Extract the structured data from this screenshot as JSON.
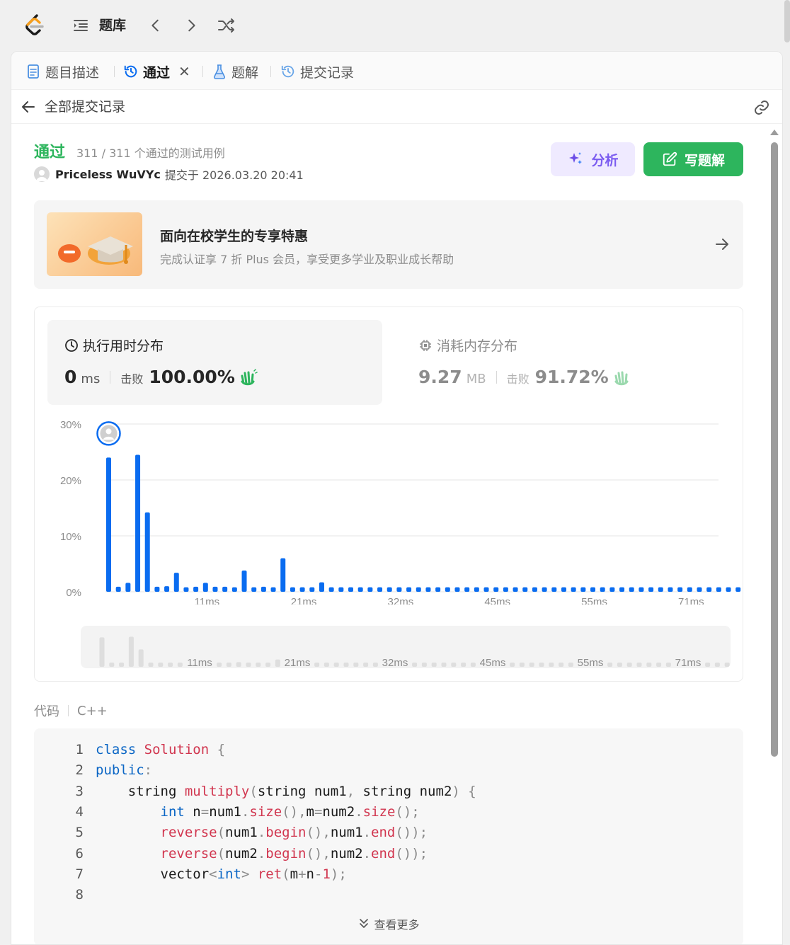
{
  "topbar": {
    "title": "题库"
  },
  "tabs": [
    {
      "label": "题目描述",
      "icon": "document-icon"
    },
    {
      "label": "通过",
      "icon": "history-icon",
      "active": true,
      "closable": true
    },
    {
      "label": "题解",
      "icon": "flask-icon"
    },
    {
      "label": "提交记录",
      "icon": "history-icon"
    }
  ],
  "subbar": {
    "title": "全部提交记录"
  },
  "submission": {
    "status": "通过",
    "cases": "311 / 311 个通过的测试用例",
    "author": "Priceless WuVYc",
    "submitted": "提交于 2026.03.20 20:41"
  },
  "actions": {
    "analyze": "分析",
    "write": "写题解"
  },
  "promo": {
    "title": "面向在校学生的专享特惠",
    "subtitle": "完成认证享 7 折 Plus 会员，享受更多学业及职业成长帮助"
  },
  "runtime": {
    "title": "执行用时分布",
    "value": "0",
    "unit": "ms",
    "beat_label": "击败",
    "beat": "100.00%"
  },
  "memory": {
    "title": "消耗内存分布",
    "value": "9.27",
    "unit": "MB",
    "beat_label": "击败",
    "beat": "91.72%"
  },
  "colors": {
    "accent_green": "#2db55d",
    "bar_blue": "#0a6cf0",
    "analyze_purple": "#7b5cf0"
  },
  "chart_data": {
    "type": "bar",
    "title": "",
    "xlabel": "",
    "ylabel": "",
    "ylim": [
      0,
      30
    ],
    "yticks": [
      "0%",
      "10%",
      "20%",
      "30%"
    ],
    "xtick_labels": [
      {
        "index": 10,
        "label": "11ms"
      },
      {
        "index": 20,
        "label": "21ms"
      },
      {
        "index": 30,
        "label": "32ms"
      },
      {
        "index": 40,
        "label": "45ms"
      },
      {
        "index": 50,
        "label": "55ms"
      },
      {
        "index": 60,
        "label": "71ms"
      }
    ],
    "values": [
      24,
      0.9,
      1.6,
      24.5,
      14.2,
      0.9,
      1.0,
      3.4,
      0.8,
      0.9,
      1.6,
      0.9,
      0.9,
      0.8,
      3.8,
      0.8,
      0.9,
      0.8,
      6.0,
      0.8,
      0.8,
      0.8,
      1.7,
      0.8,
      0.8,
      0.8,
      0.8,
      0.8,
      0.8,
      0.8,
      0.8,
      0.8,
      0.8,
      0.8,
      0.8,
      0.8,
      0.8,
      0.8,
      0.8,
      0.8,
      0.8,
      0.8,
      0.8,
      0.8,
      0.8,
      0.8,
      0.8,
      0.8,
      0.8,
      0.8,
      0.8,
      0.8,
      0.8,
      0.8,
      0.8,
      0.8,
      0.8,
      0.8,
      0.8,
      0.8,
      0.8,
      0.8,
      0.8,
      0.8,
      0.8,
      0.8
    ],
    "highlight_index": 0,
    "grid": true
  },
  "code": {
    "label": "代码",
    "language": "C++",
    "more": "查看更多",
    "lines": [
      {
        "n": "1",
        "tokens": [
          [
            "kw",
            "class"
          ],
          [
            "t",
            " "
          ],
          [
            "cls",
            "Solution"
          ],
          [
            "t",
            " "
          ],
          [
            "pn",
            "{"
          ]
        ]
      },
      {
        "n": "2",
        "tokens": [
          [
            "kw",
            "public"
          ],
          [
            "pn",
            ":"
          ]
        ]
      },
      {
        "n": "3",
        "tokens": [
          [
            "t",
            "    string "
          ],
          [
            "fn",
            "multiply"
          ],
          [
            "pn",
            "("
          ],
          [
            "t",
            "string num1"
          ],
          [
            "pn",
            ","
          ],
          [
            "t",
            " string num2"
          ],
          [
            "pn",
            ")"
          ],
          [
            "t",
            " "
          ],
          [
            "pn",
            "{"
          ]
        ]
      },
      {
        "n": "4",
        "tokens": [
          [
            "t",
            "        "
          ],
          [
            "kw",
            "int"
          ],
          [
            "t",
            " n"
          ],
          [
            "pn",
            "="
          ],
          [
            "t",
            "num1"
          ],
          [
            "pn",
            "."
          ],
          [
            "fn",
            "size"
          ],
          [
            "pn",
            "()"
          ],
          [
            "pn",
            ","
          ],
          [
            "t",
            "m"
          ],
          [
            "pn",
            "="
          ],
          [
            "t",
            "num2"
          ],
          [
            "pn",
            "."
          ],
          [
            "fn",
            "size"
          ],
          [
            "pn",
            "();"
          ]
        ]
      },
      {
        "n": "5",
        "tokens": [
          [
            "t",
            "        "
          ],
          [
            "fn",
            "reverse"
          ],
          [
            "pn",
            "("
          ],
          [
            "t",
            "num1"
          ],
          [
            "pn",
            "."
          ],
          [
            "fn",
            "begin"
          ],
          [
            "pn",
            "()"
          ],
          [
            "pn",
            ","
          ],
          [
            "t",
            "num1"
          ],
          [
            "pn",
            "."
          ],
          [
            "fn",
            "end"
          ],
          [
            "pn",
            "());"
          ]
        ]
      },
      {
        "n": "6",
        "tokens": [
          [
            "t",
            "        "
          ],
          [
            "fn",
            "reverse"
          ],
          [
            "pn",
            "("
          ],
          [
            "t",
            "num2"
          ],
          [
            "pn",
            "."
          ],
          [
            "fn",
            "begin"
          ],
          [
            "pn",
            "()"
          ],
          [
            "pn",
            ","
          ],
          [
            "t",
            "num2"
          ],
          [
            "pn",
            "."
          ],
          [
            "fn",
            "end"
          ],
          [
            "pn",
            "());"
          ]
        ]
      },
      {
        "n": "7",
        "tokens": [
          [
            "t",
            "        vector"
          ],
          [
            "pn",
            "<"
          ],
          [
            "kw",
            "int"
          ],
          [
            "pn",
            ">"
          ],
          [
            "t",
            " "
          ],
          [
            "fn",
            "ret"
          ],
          [
            "pn",
            "("
          ],
          [
            "t",
            "m"
          ],
          [
            "pn",
            "+"
          ],
          [
            "t",
            "n"
          ],
          [
            "pn",
            "-"
          ],
          [
            "num",
            "1"
          ],
          [
            "pn",
            ");"
          ]
        ]
      },
      {
        "n": "8",
        "tokens": []
      }
    ]
  }
}
